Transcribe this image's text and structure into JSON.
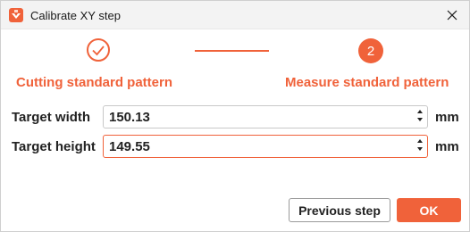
{
  "window": {
    "title": "Calibrate XY step",
    "accent_color": "#f0623a",
    "app_icon": "bambu-app-icon",
    "close_icon": "close-icon"
  },
  "steps": [
    {
      "label": "Cutting standard pattern",
      "state": "done",
      "icon": "checkmark-icon"
    },
    {
      "label": "Measure standard pattern",
      "state": "active",
      "number": "2"
    }
  ],
  "fields": {
    "width": {
      "label": "Target width",
      "value": "150.13",
      "unit": "mm"
    },
    "height": {
      "label": "Target height",
      "value": "149.55",
      "unit": "mm"
    }
  },
  "buttons": {
    "previous": "Previous step",
    "ok": "OK"
  }
}
